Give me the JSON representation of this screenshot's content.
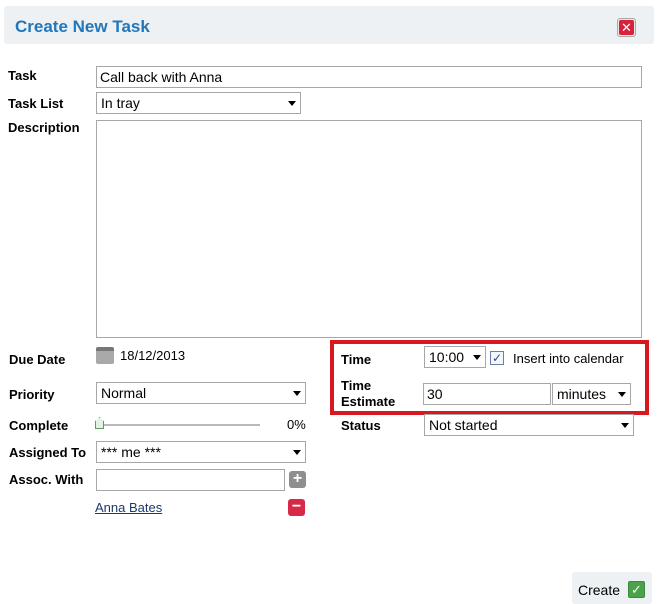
{
  "dialog": {
    "title": "Create New Task",
    "close_glyph": "✕"
  },
  "task": {
    "label": "Task",
    "value": "Call back with Anna",
    "list_label": "Task List",
    "list_value": "In tray",
    "description_label": "Description",
    "description_value": ""
  },
  "due_date": {
    "label": "Due Date",
    "value": "18/12/2013",
    "icon": "calendar-icon"
  },
  "priority": {
    "label": "Priority",
    "value": "Normal"
  },
  "complete": {
    "label": "Complete",
    "percent_text": "0%",
    "value": 0
  },
  "assigned_to": {
    "label": "Assigned To",
    "value": "*** me ***"
  },
  "assoc_with": {
    "label": "Assoc. With",
    "input_value": "",
    "contact": "Anna Bates",
    "add_glyph": "+",
    "remove_glyph": "−"
  },
  "time": {
    "label": "Time",
    "value": "10:00",
    "insert_label": "Insert into calendar",
    "insert_checked": true,
    "check_glyph": "✓"
  },
  "time_estimate": {
    "label_line1": "Time",
    "label_line2": "Estimate",
    "value": "30",
    "unit": "minutes"
  },
  "status": {
    "label": "Status",
    "value": "Not started"
  },
  "footer": {
    "create_label": "Create",
    "create_glyph": "✓"
  },
  "colors": {
    "title": "#2277bb",
    "highlight_border": "#d8171f",
    "close_red": "#d8213a",
    "add_gray": "#8f8f8f",
    "remove_red": "#d62a48",
    "create_green": "#4aa34a"
  }
}
